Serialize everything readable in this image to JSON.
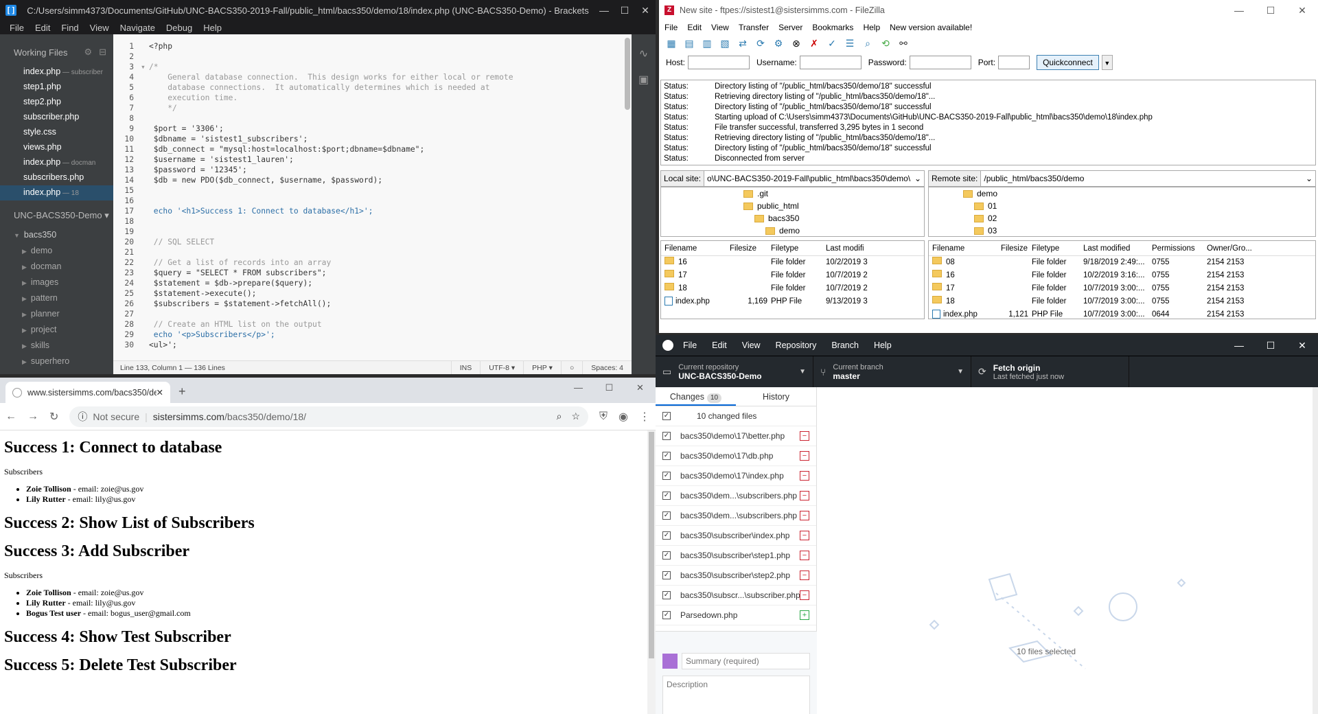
{
  "brackets": {
    "title": "C:/Users/simm4373/Documents/GitHub/UNC-BACS350-2019-Fall/public_html/bacs350/demo/18/index.php (UNC-BACS350-Demo) - Brackets",
    "menu": [
      "File",
      "Edit",
      "Find",
      "View",
      "Navigate",
      "Debug",
      "Help"
    ],
    "working_files_label": "Working Files",
    "working_files": [
      {
        "name": "index.php",
        "note": " — subscriber"
      },
      {
        "name": "step1.php",
        "note": ""
      },
      {
        "name": "step2.php",
        "note": ""
      },
      {
        "name": "subscriber.php",
        "note": ""
      },
      {
        "name": "style.css",
        "note": ""
      },
      {
        "name": "views.php",
        "note": ""
      },
      {
        "name": "index.php",
        "note": " — docman"
      },
      {
        "name": "subscribers.php",
        "note": ""
      },
      {
        "name": "index.php",
        "note": " — 18"
      }
    ],
    "project": "UNC-BACS350-Demo",
    "tree_root": "bacs350",
    "tree_children": [
      "demo",
      "docman",
      "images",
      "pattern",
      "planner",
      "project",
      "skills",
      "superhero"
    ],
    "code": [
      "<?php",
      "",
      "/*",
      "    General database connection.  This design works for either local or remote",
      "    database connections.  It automatically determines which is needed at",
      "    execution time.",
      "    */",
      "",
      " $port = '3306';",
      " $dbname = 'sistest1_subscribers';",
      " $db_connect = \"mysql:host=localhost:$port;dbname=$dbname\";",
      " $username = 'sistest1_lauren';",
      " $password = '12345';",
      " $db = new PDO($db_connect, $username, $password);",
      "",
      "",
      " echo '<h1>Success 1: Connect to database</h1>';",
      "",
      "",
      " // SQL SELECT",
      "",
      " // Get a list of records into an array",
      " $query = \"SELECT * FROM subscribers\";",
      " $statement = $db->prepare($query);",
      " $statement->execute();",
      " $subscribers = $statement->fetchAll();",
      "",
      " // Create an HTML list on the output",
      " echo '<p>Subscribers</p>';",
      "<ul>';"
    ],
    "status": {
      "position": "Line 133, Column 1 — 136 Lines",
      "mode": "INS",
      "encoding": "UTF-8",
      "language": "PHP",
      "spaces": "Spaces: 4"
    }
  },
  "chrome": {
    "tab_title": "www.sistersimms.com/bacs350/de",
    "security": "Not secure",
    "url_host": "sistersimms.com",
    "url_path": "/bacs350/demo/18/",
    "page": {
      "h1_1": "Success 1: Connect to database",
      "p1": "Subscribers",
      "list1": [
        {
          "name": "Zoie Tollison",
          "rest": " - email: zoie@us.gov"
        },
        {
          "name": "Lily Rutter",
          "rest": " - email: lily@us.gov"
        }
      ],
      "h1_2": "Success 2: Show List of Subscribers",
      "h1_3": "Success 3: Add Subscriber",
      "p2": "Subscribers",
      "list2": [
        {
          "name": "Zoie Tollison",
          "rest": " - email: zoie@us.gov"
        },
        {
          "name": "Lily Rutter",
          "rest": " - email: lily@us.gov"
        },
        {
          "name": "Bogus Test user",
          "rest": " - email: bogus_user@gmail.com"
        }
      ],
      "h1_4": "Success 4: Show Test Subscriber",
      "h1_5": "Success 5: Delete Test Subscriber"
    }
  },
  "filezilla": {
    "title": "New site - ftpes://sistest1@sistersimms.com - FileZilla",
    "menu": [
      "File",
      "Edit",
      "View",
      "Transfer",
      "Server",
      "Bookmarks",
      "Help",
      "New version available!"
    ],
    "host_label": "Host:",
    "username_label": "Username:",
    "password_label": "Password:",
    "port_label": "Port:",
    "quickconnect": "Quickconnect",
    "log": [
      {
        "k": "Status:",
        "v": "Directory listing of \"/public_html/bacs350/demo/18\" successful"
      },
      {
        "k": "Status:",
        "v": "Retrieving directory listing of \"/public_html/bacs350/demo/18\"..."
      },
      {
        "k": "Status:",
        "v": "Directory listing of \"/public_html/bacs350/demo/18\" successful"
      },
      {
        "k": "Status:",
        "v": "Starting upload of C:\\Users\\simm4373\\Documents\\GitHub\\UNC-BACS350-2019-Fall\\public_html\\bacs350\\demo\\18\\index.php"
      },
      {
        "k": "Status:",
        "v": "File transfer successful, transferred 3,295 bytes in 1 second"
      },
      {
        "k": "Status:",
        "v": "Retrieving directory listing of \"/public_html/bacs350/demo/18\"..."
      },
      {
        "k": "Status:",
        "v": "Directory listing of \"/public_html/bacs350/demo/18\" successful"
      },
      {
        "k": "Status:",
        "v": "Disconnected from server"
      }
    ],
    "local_label": "Local site:",
    "local_path": "o\\UNC-BACS350-2019-Fall\\public_html\\bacs350\\demo\\",
    "remote_label": "Remote site:",
    "remote_path": "/public_html/bacs350/demo",
    "local_tree": [
      ".git",
      "public_html",
      "bacs350",
      "demo"
    ],
    "remote_tree": [
      "demo",
      "01",
      "02",
      "03"
    ],
    "local_headers": [
      "Filename",
      "Filesize",
      "Filetype",
      "Last modifi"
    ],
    "local_files": [
      {
        "name": "16",
        "size": "",
        "type": "File folder",
        "mod": "10/2/2019 3"
      },
      {
        "name": "17",
        "size": "",
        "type": "File folder",
        "mod": "10/7/2019 2"
      },
      {
        "name": "18",
        "size": "",
        "type": "File folder",
        "mod": "10/7/2019 2"
      },
      {
        "name": "index.php",
        "size": "1,169",
        "type": "PHP File",
        "mod": "9/13/2019 3"
      }
    ],
    "remote_headers": [
      "Filename",
      "Filesize",
      "Filetype",
      "Last modified",
      "Permissions",
      "Owner/Gro..."
    ],
    "remote_files": [
      {
        "name": "08",
        "size": "",
        "type": "File folder",
        "mod": "9/18/2019 2:49:...",
        "perm": "0755",
        "own": "2154 2153"
      },
      {
        "name": "16",
        "size": "",
        "type": "File folder",
        "mod": "10/2/2019 3:16:...",
        "perm": "0755",
        "own": "2154 2153"
      },
      {
        "name": "17",
        "size": "",
        "type": "File folder",
        "mod": "10/7/2019 3:00:...",
        "perm": "0755",
        "own": "2154 2153"
      },
      {
        "name": "18",
        "size": "",
        "type": "File folder",
        "mod": "10/7/2019 3:00:...",
        "perm": "0755",
        "own": "2154 2153"
      },
      {
        "name": "index.php",
        "size": "1,121",
        "type": "PHP File",
        "mod": "10/7/2019 3:00:...",
        "perm": "0644",
        "own": "2154 2153"
      }
    ]
  },
  "github": {
    "menu": [
      "File",
      "Edit",
      "View",
      "Repository",
      "Branch",
      "Help"
    ],
    "repo_label": "Current repository",
    "repo": "UNC-BACS350-Demo",
    "branch_label": "Current branch",
    "branch": "master",
    "fetch_label": "Fetch origin",
    "fetch_sub": "Last fetched just now",
    "tab_changes": "Changes",
    "tab_changes_count": "10",
    "tab_history": "History",
    "all_label": "10 changed files",
    "files": [
      {
        "name": "bacs350\\demo\\17\\better.php",
        "status": "deleted"
      },
      {
        "name": "bacs350\\demo\\17\\db.php",
        "status": "deleted"
      },
      {
        "name": "bacs350\\demo\\17\\index.php",
        "status": "deleted"
      },
      {
        "name": "bacs350\\dem...\\subscribers.php",
        "status": "deleted"
      },
      {
        "name": "bacs350\\dem...\\subscribers.php",
        "status": "deleted"
      },
      {
        "name": "bacs350\\subscriber\\index.php",
        "status": "deleted"
      },
      {
        "name": "bacs350\\subscriber\\step1.php",
        "status": "deleted"
      },
      {
        "name": "bacs350\\subscriber\\step2.php",
        "status": "deleted"
      },
      {
        "name": "bacs350\\subscr...\\subscriber.php",
        "status": "deleted"
      },
      {
        "name": "Parsedown.php",
        "status": "added"
      }
    ],
    "summary_placeholder": "Summary (required)",
    "description_placeholder": "Description",
    "selected_text": "10 files selected"
  }
}
